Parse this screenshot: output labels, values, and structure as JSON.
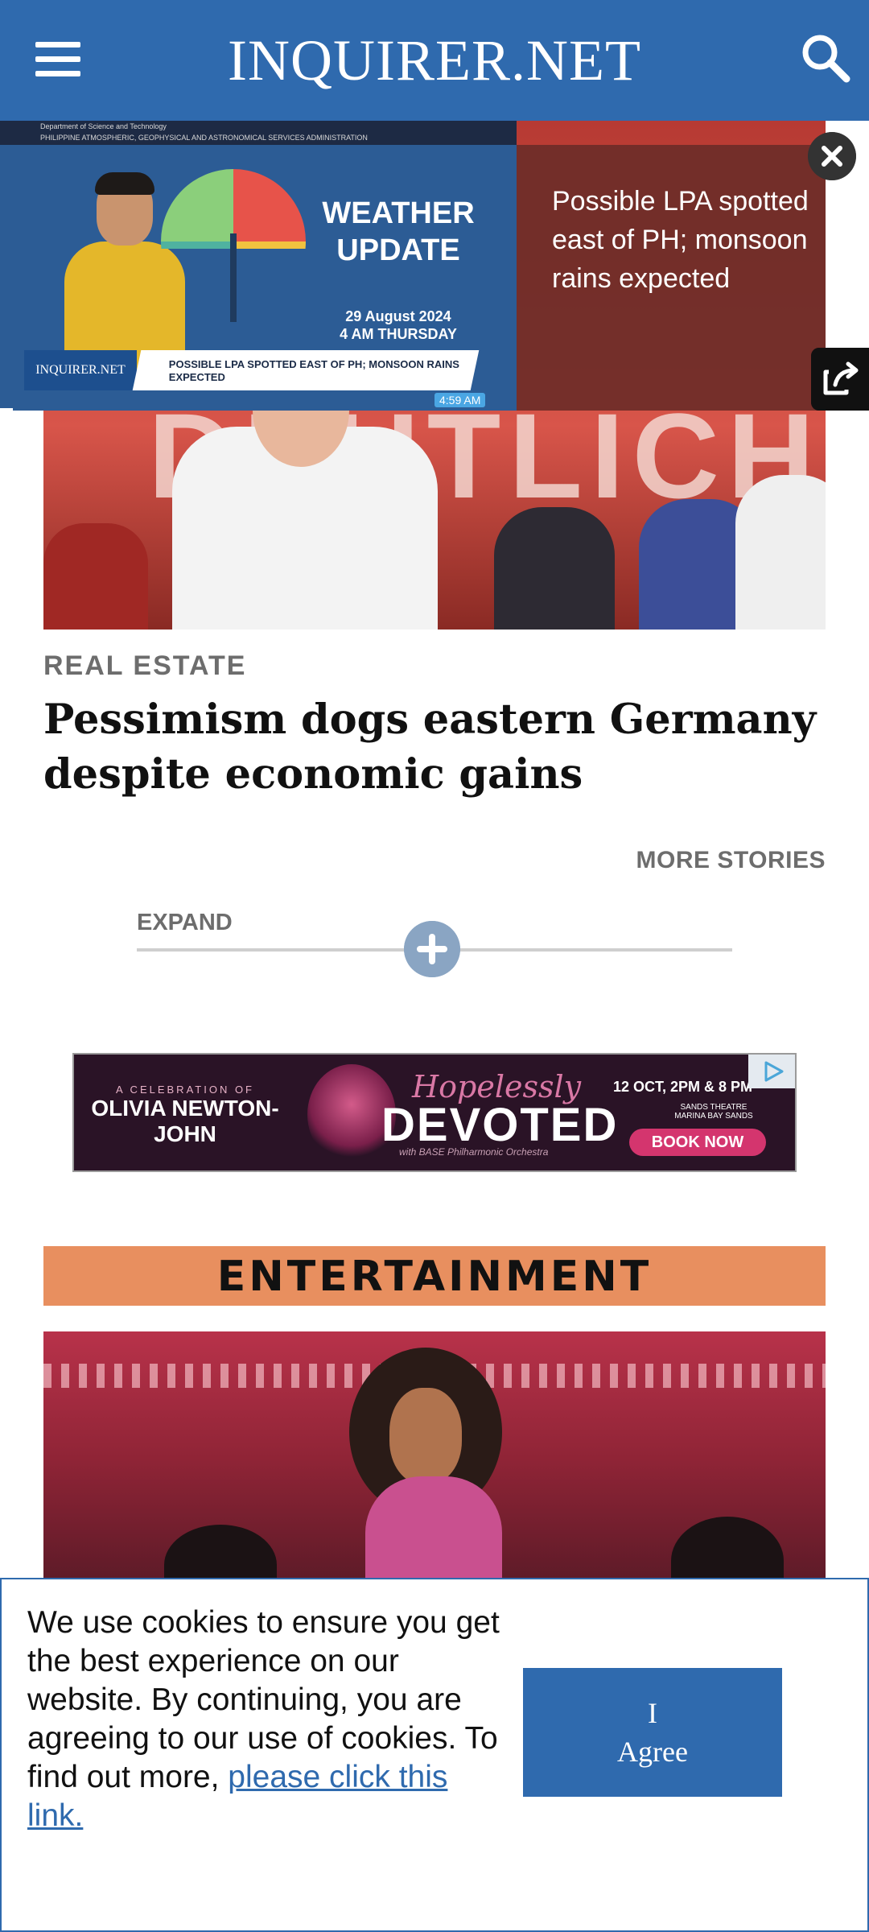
{
  "header": {
    "logo": "INQUIRER.NET",
    "menu_icon": "hamburger-icon",
    "search_icon": "search-icon",
    "background": "#2f6aae"
  },
  "video": {
    "title": "Possible LPA spotted east of PH; monsoon rains expected",
    "thumbnail": {
      "agency_line1": "Department of Science and Technology",
      "agency_line2": "PHILIPPINE ATMOSPHERIC, GEOPHYSICAL AND ASTRONOMICAL SERVICES ADMINISTRATION",
      "weather_title": "WEATHER UPDATE",
      "date": "29 August 2024",
      "time_day": "4 AM  THURSDAY",
      "brand": "INQUIRER.NET",
      "lower_third": "POSSIBLE LPA SPOTTED EAST OF PH; MONSOON RAINS EXPECTED",
      "timestamp": "4:59 AM"
    },
    "close_icon": "close-icon",
    "external_icon": "external-link-icon"
  },
  "article": {
    "category": "REAL ESTATE",
    "headline": "Pessimism dogs eastern Germany despite economic gains",
    "hero_banner_text": "DEUTLICH"
  },
  "more_stories": "MORE STORIES",
  "expand": {
    "label": "EXPAND",
    "icon": "plus-icon"
  },
  "ad": {
    "small_line": "A CELEBRATION OF",
    "name": "OLIVIA NEWTON-JOHN",
    "script": "Hopelessly",
    "title": "DEVOTED",
    "subtitle": "with BASE Philharmonic Orchestra",
    "date": "12 OCT, 2PM & 8 PM",
    "venue": "SANDS THEATRE MARINA BAY SANDS",
    "cta": "BOOK NOW",
    "choice_icon": "adchoices-icon"
  },
  "section": {
    "title": "ENTERTAINMENT",
    "color": "#e88f5f"
  },
  "cookie": {
    "text": "We use cookies to ensure you get the best experience on our website. By continuing, you are agreeing to our use of cookies. To find out more, ",
    "link": "please click this link.",
    "button": "I Agree"
  }
}
